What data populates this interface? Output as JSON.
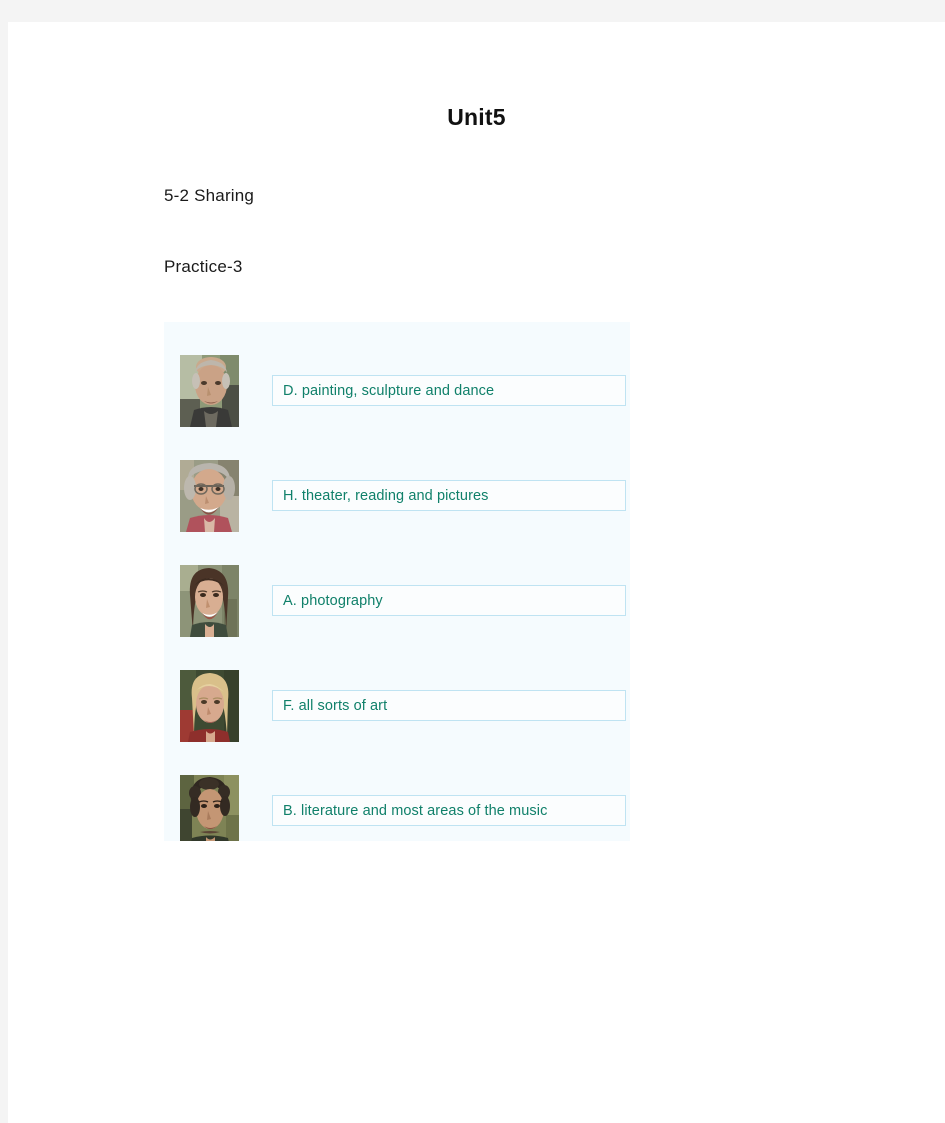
{
  "document": {
    "title": "Unit5",
    "section": "5-2  Sharing",
    "practice": "Practice-3"
  },
  "colors": {
    "page_background": "#ffffff",
    "outer_background": "#f4f4f4",
    "panel_background": "#f5fbfe",
    "answer_border": "#bfe3f2",
    "answer_text": "#10806a",
    "heading_text": "#1a1a1a"
  },
  "exercise": {
    "rows": [
      {
        "photo_name": "person-photo-bald-man",
        "photo_alt": "Older bald man with gray side hair in dark jacket outdoors",
        "answer": "D. painting, sculpture and dance"
      },
      {
        "photo_name": "person-photo-gray-haired-woman",
        "photo_alt": "Smiling older woman with gray hair and glasses in pink top",
        "answer": "H. theater, reading and pictures"
      },
      {
        "photo_name": "person-photo-dark-haired-woman",
        "photo_alt": "Young woman with long dark brown hair smiling",
        "answer": "A. photography"
      },
      {
        "photo_name": "person-photo-blonde-woman",
        "photo_alt": "Blonde woman in red top against dark green background",
        "answer": "F.  all sorts of art"
      },
      {
        "photo_name": "person-photo-curly-haired-man",
        "photo_alt": "Young man with curly dark hair against olive background",
        "answer": "B. literature and most areas of the music"
      }
    ]
  }
}
